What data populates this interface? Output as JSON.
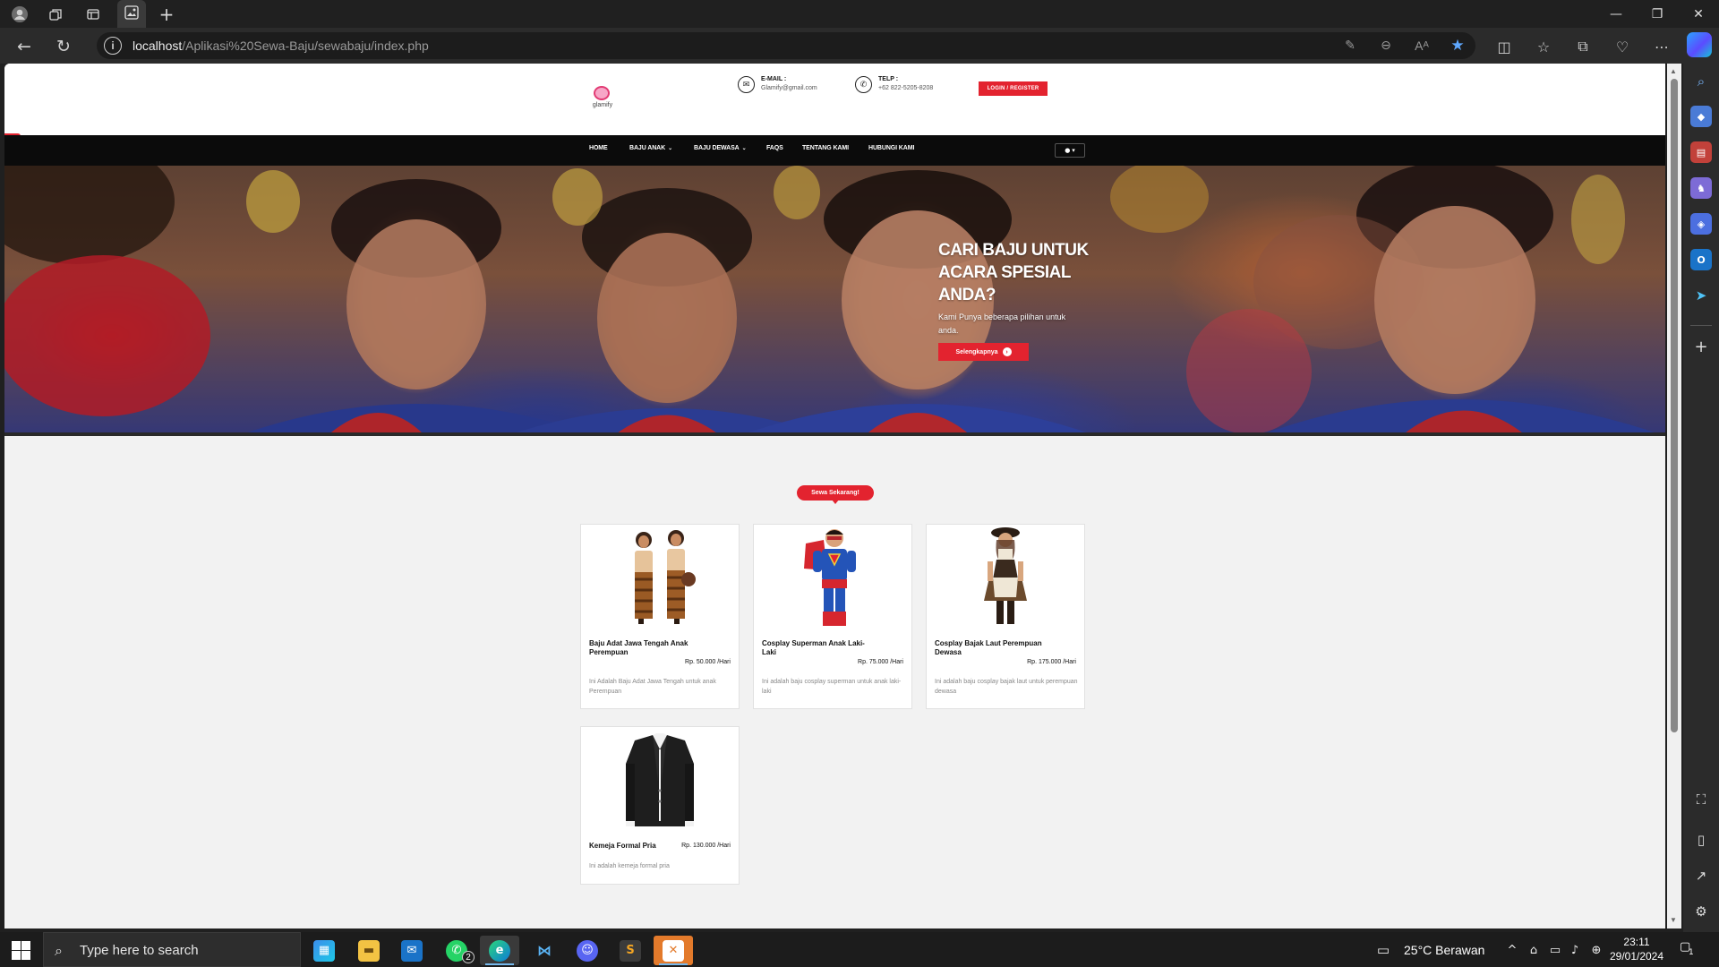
{
  "browser": {
    "tab_title": "",
    "url_host": "localhost",
    "url_path": "/Aplikasi%20Sewa-Baju/sewabaju/index.php",
    "icons": [
      "profile-icon",
      "workspaces-icon",
      "tab-actions-icon",
      "new-tab-icon",
      "back-icon",
      "refresh-icon",
      "site-info-icon",
      "edit-icon",
      "zoom-out-icon",
      "read-aloud-icon",
      "favorite-star-icon",
      "split-screen-icon",
      "favorites-icon",
      "collections-icon",
      "browser-essentials-icon",
      "more-icon",
      "copilot-icon"
    ]
  },
  "site": {
    "logo_text": "glamify",
    "email_label": "E-MAIL :",
    "email_value": "Glamify@gmail.com",
    "phone_label": "TELP :",
    "phone_value": "+62 822-5205-8208",
    "login_label": "LOGIN / REGISTER",
    "user_menu": "▾"
  },
  "nav": {
    "items": [
      {
        "label": "HOME",
        "has_caret": false
      },
      {
        "label": "BAJU ANAK",
        "has_caret": true
      },
      {
        "label": "BAJU DEWASA",
        "has_caret": true
      },
      {
        "label": "FAQS",
        "has_caret": false
      },
      {
        "label": "TENTANG KAMI",
        "has_caret": false
      },
      {
        "label": "HUBUNGI KAMI",
        "has_caret": false
      }
    ]
  },
  "hero": {
    "title": "CARI BAJU UNTUK ACARA SPESIAL ANDA?",
    "subtitle": "Kami Punya beberapa pilihan untuk anda.",
    "button_label": "Selengkapnya"
  },
  "products": {
    "section_label": "Sewa Sekarang!",
    "items": [
      {
        "name": "Baju Adat Jawa Tengah Anak Perempuan",
        "price": "Rp. 50.000 /Hari",
        "description": "Ini Adalah Baju Adat Jawa Tengah untuk anak Perempuan",
        "image": "kids-traditional-javanese-costume"
      },
      {
        "name": "Cosplay Superman Anak Laki-Laki",
        "price": "Rp. 75.000 /Hari",
        "description": "Ini adalah baju cosplay superman untuk anak laki-laki",
        "image": "kid-superman-costume"
      },
      {
        "name": "Cosplay Bajak Laut Perempuan Dewasa",
        "price": "Rp. 175.000 /Hari",
        "description": "Ini adalah baju cosplay bajak laut untuk perempuan dewasa",
        "image": "female-pirate-costume"
      },
      {
        "name": "Kemeja Formal Pria",
        "price": "Rp. 130.000 /Hari",
        "description": "Ini adalah kemeja formal pria",
        "image": "men-black-suit"
      }
    ]
  },
  "taskbar": {
    "search_placeholder": "Type here to search",
    "weather": "25°C  Berawan",
    "time": "23:11",
    "date": "29/01/2024",
    "whatsapp_badge": "2",
    "notification_count": "1"
  }
}
